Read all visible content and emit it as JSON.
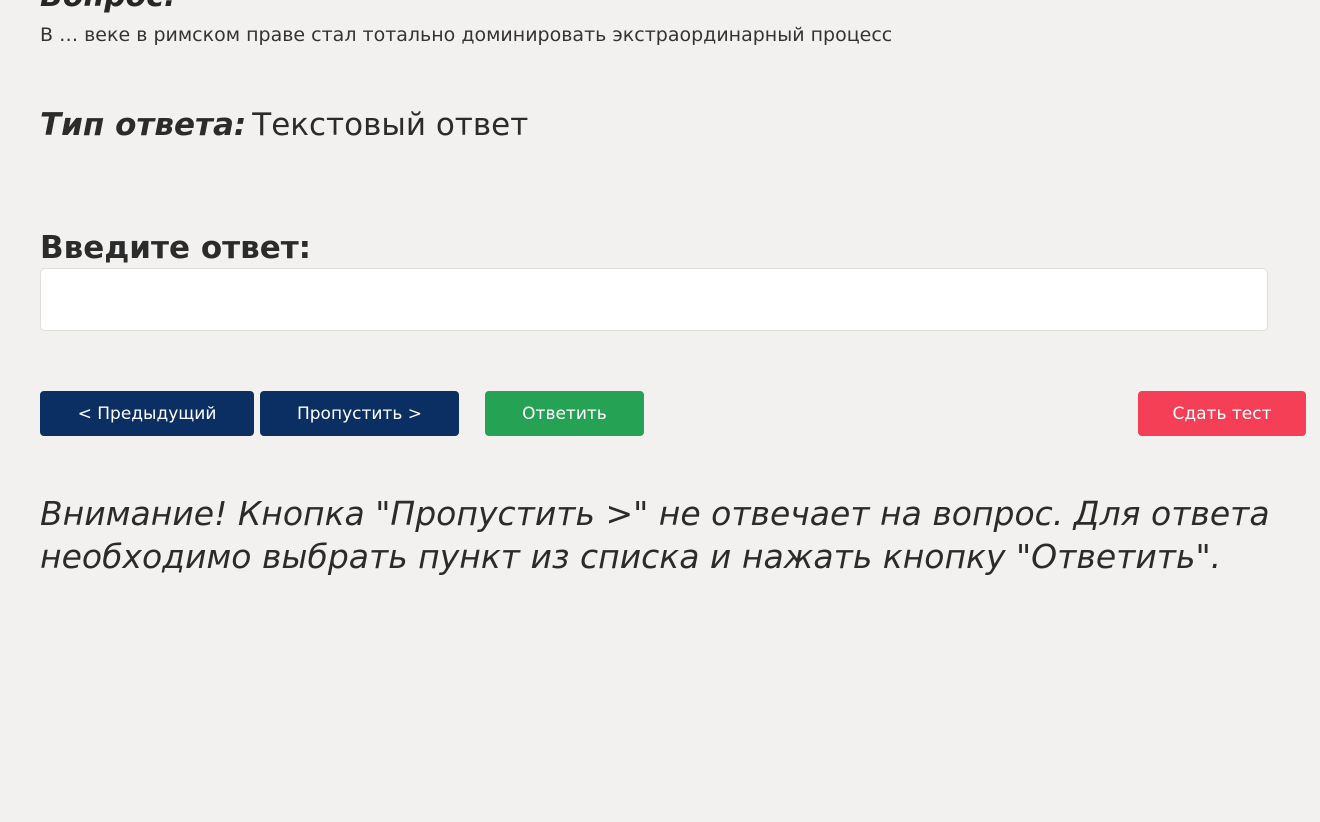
{
  "question": {
    "heading": "Вопрос:",
    "text": "В … веке в римском праве стал тотально доминировать экстраординарный процесс"
  },
  "answer_type": {
    "label": "Тип ответа:",
    "value": "Текстовый ответ"
  },
  "answer_input": {
    "label": "Введите ответ:",
    "value": "",
    "placeholder": ""
  },
  "buttons": {
    "prev_label": "< Предыдущий",
    "skip_label": "Пропустить >",
    "answer_label": "Ответить",
    "submit_label": "Сдать тест"
  },
  "colors": {
    "background": "#f2f1ef",
    "nav_button": "#0c2f63",
    "answer_button": "#26a254",
    "submit_button": "#f53f57"
  },
  "warning": {
    "text": "Внимание! Кнопка \"Пропустить >\" не отвечает на вопрос. Для ответа необходимо выбрать пункт из списка и нажать кнопку \"Ответить\"."
  }
}
